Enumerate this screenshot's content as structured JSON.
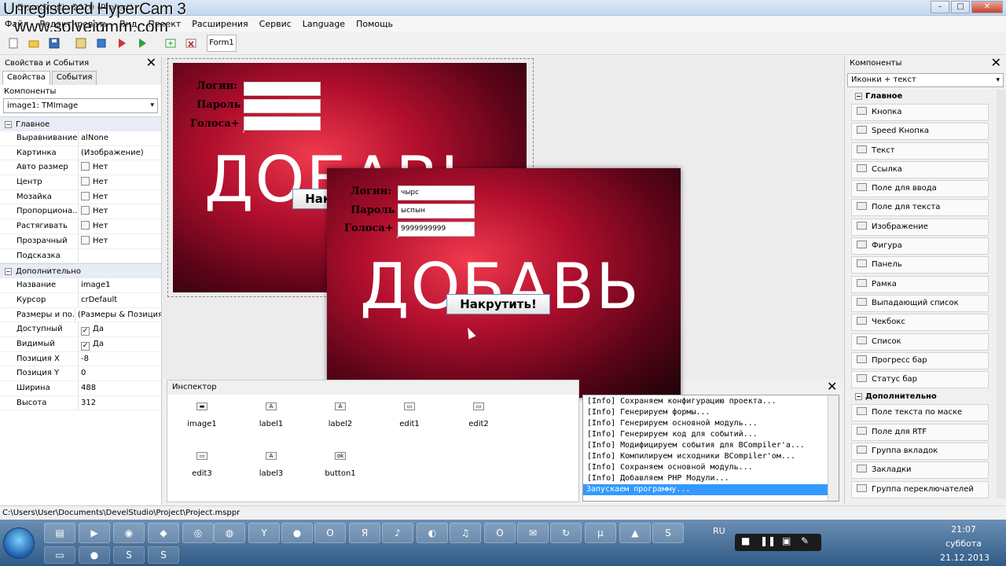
{
  "window": {
    "app_title": "DevelStudio 2010 (Project)",
    "watermark_line1": "Unregistered HyperCam 3",
    "watermark_line2": "www.solveigmm.com",
    "min_label": "–",
    "max_label": "□",
    "close_label": "✕"
  },
  "menu": [
    "Файл",
    "Редактировать",
    "Вид",
    "Проект",
    "Расширения",
    "Сервис",
    "Language",
    "Помощь"
  ],
  "toolbar": {
    "form_tab": "Form1"
  },
  "left_panel": {
    "title": "Свойства и События",
    "close": "✕",
    "tabs": [
      "Свойства",
      "События"
    ],
    "components_label": "Компоненты",
    "component_selected": "image1: TMImage",
    "group_main": "Главное",
    "group_extra": "Дополнительно",
    "props_main": [
      {
        "name": "Выравнивание",
        "value": "alNone"
      },
      {
        "name": "Картинка",
        "value": "(Изображение)"
      },
      {
        "name": "Авто размер",
        "value": "Нет",
        "check": false
      },
      {
        "name": "Центр",
        "value": "Нет",
        "check": false
      },
      {
        "name": "Мозайка",
        "value": "Нет",
        "check": false
      },
      {
        "name": "Пропорциона...",
        "value": "Нет",
        "check": false
      },
      {
        "name": "Растягивать",
        "value": "Нет",
        "check": false
      },
      {
        "name": "Прозрачный",
        "value": "Нет",
        "check": false
      },
      {
        "name": "Подсказка",
        "value": ""
      }
    ],
    "props_extra": [
      {
        "name": "Название",
        "value": "image1"
      },
      {
        "name": "Курсор",
        "value": "crDefault"
      },
      {
        "name": "Размеры и по...",
        "value": "(Размеры & Позиция)"
      },
      {
        "name": "Доступный",
        "value": "Да",
        "check": true
      },
      {
        "name": "Видимый",
        "value": "Да",
        "check": true
      },
      {
        "name": "Позиция X",
        "value": "-8"
      },
      {
        "name": "Позиция Y",
        "value": "0"
      },
      {
        "name": "Ширина",
        "value": "488"
      },
      {
        "name": "Высота",
        "value": "312"
      }
    ]
  },
  "design_form": {
    "label_login": "Логин:",
    "label_password": "Пароль",
    "label_votes": "Голоса+",
    "big_text": "ДОБАВЬ",
    "button_text": "Накрутить!"
  },
  "run_window": {
    "label_login": "Логин:",
    "label_password": "Пароль",
    "label_votes": "Голоса+",
    "login_value": "чырс",
    "password_value": "ыспын",
    "votes_value": "9999999999",
    "big_text": "ДОБАВЬ",
    "button_text": "Накрутить!"
  },
  "inspector": {
    "title": "Инспектор",
    "items": [
      {
        "label": "image1",
        "icon": "image-icon"
      },
      {
        "label": "label1",
        "icon": "label-icon"
      },
      {
        "label": "label2",
        "icon": "label-icon"
      },
      {
        "label": "edit1",
        "icon": "edit-icon"
      },
      {
        "label": "edit2",
        "icon": "edit-icon"
      },
      {
        "label": "edit3",
        "icon": "edit-icon"
      },
      {
        "label": "label3",
        "icon": "label-icon"
      },
      {
        "label": "button1",
        "icon": "button-icon"
      }
    ]
  },
  "log": {
    "close": "✕",
    "lines": [
      "[Info] Сохраняем конфигурацию проекта...",
      "[Info] Генерируем формы...",
      "[Info] Генерируем основной модуль...",
      "[Info] Генерируем код для событий...",
      "[Info] Модифицируем события для BCompiler'a...",
      "[Info] Компилируем исходники BCompiler'ом...",
      "[Info] Сохраняем основной модуль...",
      "[Info] Добавляем PHP Модули..."
    ],
    "selected_line": "Запускаем программу..."
  },
  "right_panel": {
    "title": "Компоненты",
    "close": "✕",
    "view_mode": "Иконки + текст",
    "cat_main": "Главное",
    "cat_extra": "Дополнительно",
    "items_main": [
      "Кнопка",
      "Speed Кнопка",
      "Текст",
      "Ссылка",
      "Поле для ввода",
      "Поле для текста",
      "Изображение",
      "Фигура",
      "Панель",
      "Рамка",
      "Выпадающий список",
      "Чекбокс",
      "Список",
      "Прогресс бар",
      "Статус бар"
    ],
    "items_extra": [
      "Поле текста по маске",
      "Поле для RTF",
      "Группа вкладок",
      "Закладки",
      "Группа переключателей"
    ]
  },
  "status_path": "C:\\Users\\User\\Documents\\DevelStudio\\Project\\Project.msppr",
  "taskbar": {
    "lang": "RU",
    "time": "21:07",
    "day": "суббота",
    "date": "21.12.2013"
  }
}
